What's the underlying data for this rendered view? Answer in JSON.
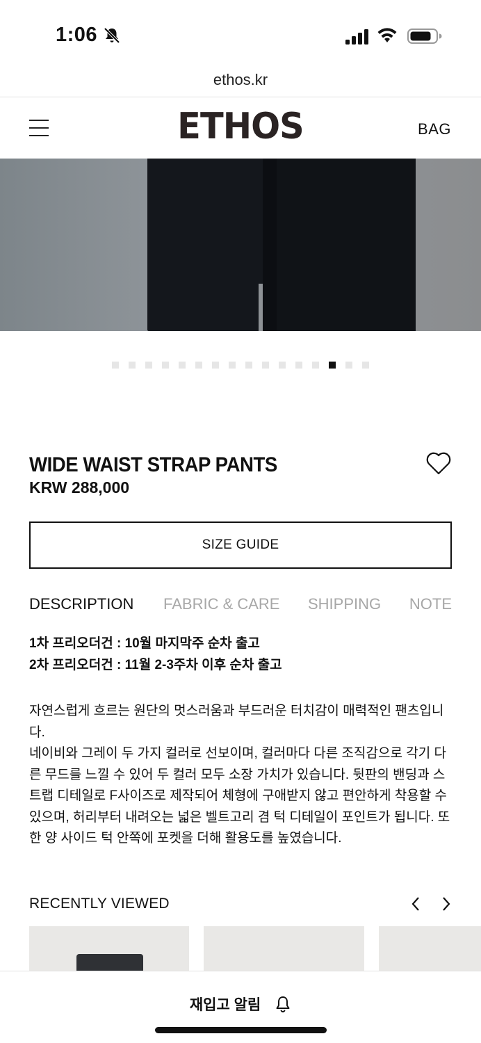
{
  "status_bar": {
    "time": "1:06",
    "icons": [
      "bell-slash-icon",
      "cellular-signal-icon",
      "wifi-icon",
      "battery-icon"
    ]
  },
  "browser": {
    "url": "ethos.kr"
  },
  "header": {
    "logo": "ETHOS",
    "bag_label": "BAG",
    "menu_icon": "hamburger-menu-icon"
  },
  "gallery": {
    "total_images": 16,
    "active_index": 14
  },
  "product": {
    "name": "WIDE WAIST STRAP PANTS",
    "price": "KRW 288,000",
    "wishlist_icon": "heart-icon",
    "size_guide_label": "SIZE GUIDE"
  },
  "tabs": {
    "description": "DESCRIPTION",
    "fabric_care": "FABRIC & CARE",
    "shipping": "SHIPPING",
    "note": "NOTE",
    "active": "DESCRIPTION"
  },
  "description": {
    "preorder_1": "1차 프리오더건 : 10월 마지막주 순차 출고",
    "preorder_2": "2차 프리오더건 : 11월 2-3주차 이후 순차 출고",
    "body": "자연스럽게 흐르는 원단의 멋스러움과 부드러운 터치감이 매력적인 팬츠입니다.\n네이비와 그레이 두 가지 컬러로 선보이며, 컬러마다 다른 조직감으로 각기 다른 무드를 느낄 수 있어 두 컬러 모두 소장 가치가 있습니다. 뒷판의 밴딩과 스트랩 디테일로 F사이즈로 제작되어 체형에 구애받지 않고 편안하게 착용할 수 있으며, 허리부터 내려오는 넓은 벨트고리 겸 턱 디테일이 포인트가 됩니다. 또한 양 사이드 턱 안쪽에 포켓을 더해 활용도를 높였습니다."
  },
  "recently_viewed": {
    "title": "RECENTLY VIEWED",
    "prev_icon": "chevron-left-icon",
    "next_icon": "chevron-right-icon"
  },
  "bottom_bar": {
    "restock_label": "재입고 알림",
    "restock_icon": "bell-icon"
  }
}
